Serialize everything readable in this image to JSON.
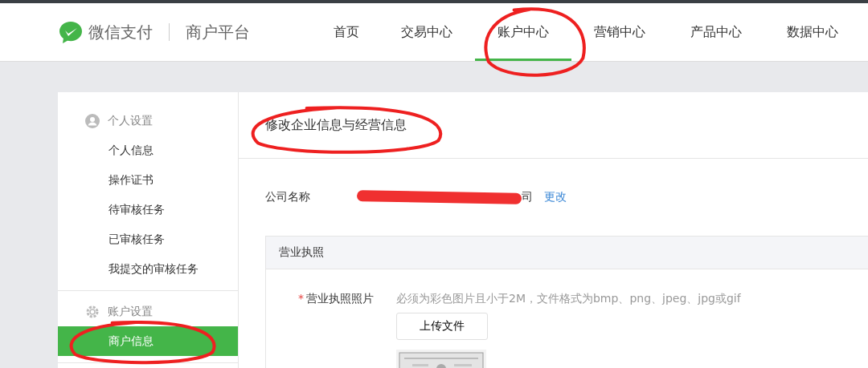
{
  "header": {
    "brand": "微信支付",
    "product": "商户平台",
    "nav": [
      {
        "label": "首页",
        "selected": false
      },
      {
        "label": "交易中心",
        "selected": false
      },
      {
        "label": "账户中心",
        "selected": true
      },
      {
        "label": "营销中心",
        "selected": false
      },
      {
        "label": "产品中心",
        "selected": false
      },
      {
        "label": "数据中心",
        "selected": false
      }
    ]
  },
  "sidebar": {
    "groups": [
      {
        "title": "个人设置",
        "items": [
          {
            "label": "个人信息",
            "selected": false
          },
          {
            "label": "操作证书",
            "selected": false
          },
          {
            "label": "待审核任务",
            "selected": false
          },
          {
            "label": "已审核任务",
            "selected": false
          },
          {
            "label": "我提交的审核任务",
            "selected": false
          }
        ]
      },
      {
        "title": "账户设置",
        "items": [
          {
            "label": "商户信息",
            "selected": true
          }
        ]
      }
    ]
  },
  "main": {
    "title": "修改企业信息与经营信息",
    "company": {
      "label": "公司名称",
      "value": "司",
      "redacted": true,
      "action": "更改"
    },
    "section": {
      "title": "营业执照",
      "field": {
        "label": "营业执照照片",
        "required": true,
        "required_mark": "*",
        "hint": "必须为彩色图片且小于2M，文件格式为bmp、png、jpeg、jpg或gif",
        "button": "上传文件"
      }
    }
  }
}
